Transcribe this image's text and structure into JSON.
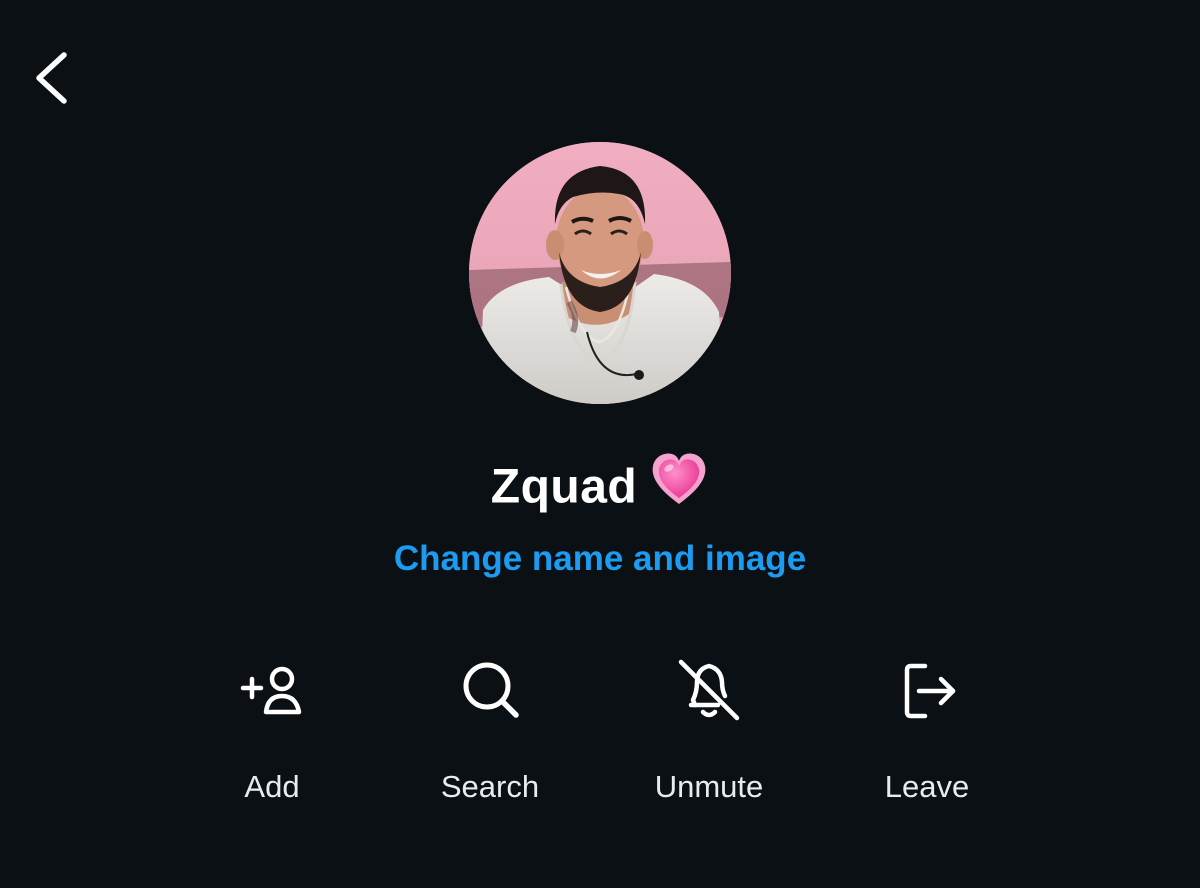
{
  "header": {
    "back_icon": "chevron-left-icon"
  },
  "group": {
    "name": "Zquad",
    "emoji": "heart-emoji",
    "change_link": "Change name and image"
  },
  "actions": [
    {
      "label": "Add",
      "icon": "add-person-icon"
    },
    {
      "label": "Search",
      "icon": "search-icon"
    },
    {
      "label": "Unmute",
      "icon": "bell-muted-icon"
    },
    {
      "label": "Leave",
      "icon": "leave-icon"
    }
  ],
  "colors": {
    "background": "#0b1014",
    "accent": "#1d9bf0",
    "text": "#ffffff",
    "heart": "#f25ba8"
  }
}
